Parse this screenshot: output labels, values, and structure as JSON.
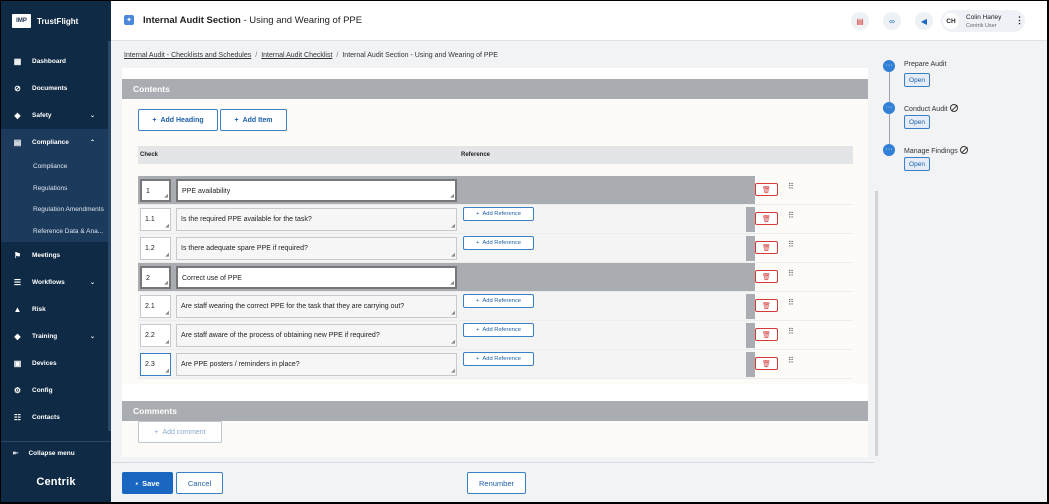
{
  "sidebar": {
    "brand_logo": "IMP",
    "brand_name": "TrustFlight",
    "items": [
      {
        "label": "Dashboard",
        "icon": "dashboard-icon"
      },
      {
        "label": "Documents",
        "icon": "paperclip-icon"
      },
      {
        "label": "Safety",
        "icon": "shield-icon",
        "chevron": "⌄"
      },
      {
        "label": "Compliance",
        "icon": "compliance-icon",
        "chevron": "⌃"
      },
      {
        "label": "Meetings",
        "icon": "meetings-icon"
      },
      {
        "label": "Workflows",
        "icon": "workflows-icon",
        "chevron": "⌄"
      },
      {
        "label": "Risk",
        "icon": "warning-icon"
      },
      {
        "label": "Training",
        "icon": "graduation-cap-icon",
        "chevron": "⌄"
      },
      {
        "label": "Devices",
        "icon": "devices-icon"
      },
      {
        "label": "Config",
        "icon": "config-icon"
      },
      {
        "label": "Contacts",
        "icon": "contacts-icon"
      }
    ],
    "compliance_sub": [
      "Compliance",
      "Regulations",
      "Regulation Amendments",
      "Reference Data & Ana..."
    ],
    "collapse_label": "Collapse menu",
    "footer_logo": "Centrik"
  },
  "header": {
    "title_bold": "Internal Audit Section",
    "title_rest": " - Using and Wearing of PPE",
    "user_initials": "CH",
    "user_name": "Colin Harley",
    "user_role": "Centrik User"
  },
  "breadcrumb": {
    "items": [
      "Internal Audit - Checklists and Schedules",
      "Internal Audit Checklist"
    ],
    "current": "Internal Audit Section - Using and Wearing of PPE",
    "separator": "/"
  },
  "contents": {
    "title": "Contents",
    "add_heading": "Add Heading",
    "add_item": "Add Item",
    "col_check": "Check",
    "col_reference": "Reference",
    "add_reference": "Add Reference",
    "rows": [
      {
        "num": "1",
        "text": "PPE availability",
        "type": "heading"
      },
      {
        "num": "1.1",
        "text": "Is the required PPE available for the task?",
        "type": "item"
      },
      {
        "num": "1.2",
        "text": "Is there adequate spare PPE if required?",
        "type": "item"
      },
      {
        "num": "2",
        "text": "Correct use of PPE",
        "type": "heading"
      },
      {
        "num": "2.1",
        "text": "Are staff wearing the correct PPE for the task that they are carrying out?",
        "type": "item"
      },
      {
        "num": "2.2",
        "text": "Are staff aware of the process of obtaining new PPE if required?",
        "type": "item"
      },
      {
        "num": "2.3",
        "text": "Are PPE posters / reminders in place?",
        "type": "item"
      }
    ]
  },
  "comments": {
    "title": "Comments",
    "add_comment": "Add comment"
  },
  "footer": {
    "save": "Save",
    "cancel": "Cancel",
    "renumber": "Renumber"
  },
  "workflow": {
    "open_label": "Open",
    "steps": [
      {
        "label": "Prepare Audit",
        "blocked": false
      },
      {
        "label": "Conduct Audit",
        "blocked": true
      },
      {
        "label": "Manage Findings",
        "blocked": true
      }
    ]
  },
  "colors": {
    "sidebar_bg": "#0f2a44",
    "accent": "#1a67c2",
    "danger": "#d33a3a",
    "section_header": "#a9acb0"
  }
}
